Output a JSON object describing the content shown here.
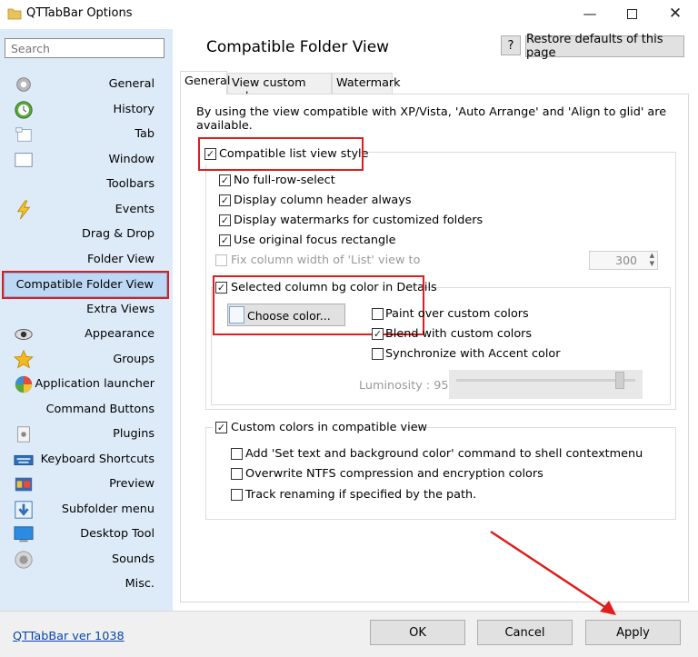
{
  "window": {
    "title": "QTTabBar Options"
  },
  "search": {
    "placeholder": "Search"
  },
  "sidebar": {
    "items": [
      {
        "label": "General",
        "icon": "gear-icon"
      },
      {
        "label": "History",
        "icon": "history-clock-icon"
      },
      {
        "label": "Tab",
        "icon": "tab-icon"
      },
      {
        "label": "Window",
        "icon": "window-icon"
      },
      {
        "label": "Toolbars",
        "icon": "toolbar-icon"
      },
      {
        "label": "Events",
        "icon": "lightning-icon"
      },
      {
        "label": "Drag & Drop",
        "icon": "drag-drop-icon"
      },
      {
        "label": "Folder View",
        "icon": "folder-view-icon"
      },
      {
        "label": "Compatible Folder View",
        "icon": "compatible-folder-view-icon",
        "selected": true
      },
      {
        "label": "Extra Views",
        "icon": "extra-views-icon"
      },
      {
        "label": "Appearance",
        "icon": "eye-icon"
      },
      {
        "label": "Groups",
        "icon": "star-icon"
      },
      {
        "label": "Application launcher",
        "icon": "app-launcher-icon"
      },
      {
        "label": "Command Buttons",
        "icon": "command-buttons-icon"
      },
      {
        "label": "Plugins",
        "icon": "plugin-icon"
      },
      {
        "label": "Keyboard Shortcuts",
        "icon": "keyboard-icon"
      },
      {
        "label": "Preview",
        "icon": "preview-icon"
      },
      {
        "label": "Subfolder menu",
        "icon": "subfolder-arrow-icon"
      },
      {
        "label": "Desktop Tool",
        "icon": "desktop-icon"
      },
      {
        "label": "Sounds",
        "icon": "speaker-icon"
      },
      {
        "label": "Misc.",
        "icon": "misc-icon"
      }
    ]
  },
  "header": {
    "title": "Compatible Folder View",
    "help_label": "?",
    "restore_label": "Restore defaults of this page"
  },
  "tabs": [
    {
      "label": "General",
      "active": true
    },
    {
      "label": "View custom colors",
      "active": false
    },
    {
      "label": "Watermark",
      "active": false
    }
  ],
  "general": {
    "description": "By using the view compatible with XP/Vista, 'Auto Arrange' and 'Align to glid' are available.",
    "compatible_list_view_style": {
      "label": "Compatible list view style",
      "checked": true
    },
    "options": [
      {
        "label": "No full-row-select",
        "checked": true
      },
      {
        "label": "Display column header always",
        "checked": true
      },
      {
        "label": "Display watermarks for customized folders",
        "checked": true
      },
      {
        "label": "Use original focus rectangle",
        "checked": true
      }
    ],
    "fix_column_width": {
      "label": "Fix column width of 'List' view to",
      "checked": false,
      "value": "300"
    },
    "selected_column": {
      "label": "Selected column bg color in Details",
      "checked": true,
      "choose_color_label": "Choose color...",
      "paint_over": {
        "label": "Paint over custom colors",
        "checked": false
      },
      "blend": {
        "label": "Blend with custom colors",
        "checked": true
      },
      "sync_accent": {
        "label": "Synchronize with Accent color",
        "checked": false
      },
      "luminosity_label": "Luminosity : 95"
    },
    "custom_colors": {
      "label": "Custom colors in compatible view",
      "checked": true,
      "options": [
        {
          "label": "Add 'Set text and background color' command to shell contextmenu",
          "checked": false
        },
        {
          "label": "Overwrite NTFS compression and encryption colors",
          "checked": false
        },
        {
          "label": "Track renaming if specified by the path.",
          "checked": false
        }
      ]
    }
  },
  "footer": {
    "version_link": "QTTabBar ver 1038",
    "ok_label": "OK",
    "cancel_label": "Cancel",
    "apply_label": "Apply"
  },
  "colors": {
    "sidebar_bg": "#ddebf8",
    "highlight": "#e11c1c",
    "selected_bg": "#bcd8f5"
  }
}
